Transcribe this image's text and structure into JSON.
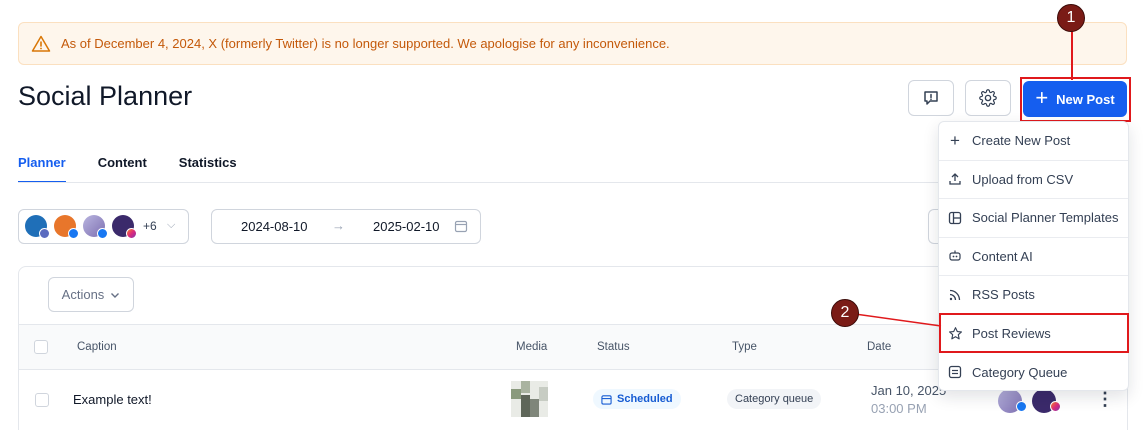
{
  "banner": {
    "text": "As of December 4, 2024, X (formerly Twitter) is no longer supported. We apologise for any inconvenience.",
    "icon": "warning-triangle-icon"
  },
  "header": {
    "title": "Social Planner",
    "new_post_label": "New Post"
  },
  "tabs": [
    {
      "label": "Planner",
      "active": true
    },
    {
      "label": "Content",
      "active": false
    },
    {
      "label": "Statistics",
      "active": false
    }
  ],
  "filters": {
    "extra_accounts": "+6",
    "date_from": "2024-08-10",
    "date_to": "2025-02-10"
  },
  "table": {
    "actions_label": "Actions",
    "columns": [
      "Caption",
      "Media",
      "Status",
      "Type",
      "Date"
    ],
    "rows": [
      {
        "caption": "Example text!",
        "status": "Scheduled",
        "type": "Category queue",
        "date": "Jan 10, 2025",
        "time": "03:00 PM"
      }
    ]
  },
  "menu": {
    "items": [
      {
        "label": "Create New Post",
        "icon": "plus-icon"
      },
      {
        "label": "Upload from CSV",
        "icon": "upload-icon"
      },
      {
        "label": "Social Planner Templates",
        "icon": "template-icon"
      },
      {
        "label": "Content AI",
        "icon": "robot-icon"
      },
      {
        "label": "RSS Posts",
        "icon": "rss-icon"
      },
      {
        "label": "Post Reviews",
        "icon": "star-icon"
      },
      {
        "label": "Category Queue",
        "icon": "queue-icon"
      }
    ]
  },
  "annotations": {
    "badge1": "1",
    "badge2": "2"
  },
  "colors": {
    "primary": "#155eef",
    "annotation": "#e0191c",
    "warning": "#c4590a"
  }
}
